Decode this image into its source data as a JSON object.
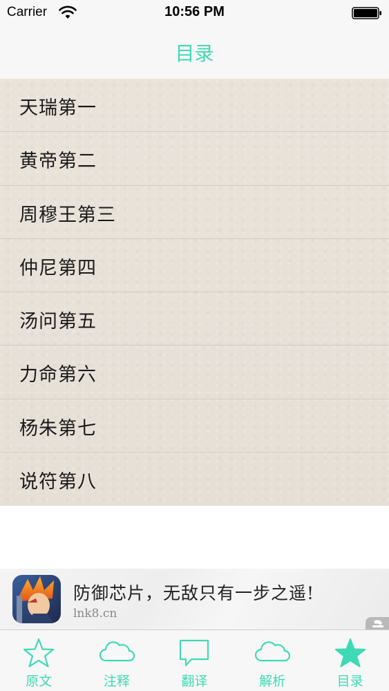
{
  "status_bar": {
    "carrier": "Carrier",
    "time": "10:56 PM",
    "wifi_icon": "wifi-icon",
    "battery_icon": "battery-icon"
  },
  "nav": {
    "title": "目录"
  },
  "toc": {
    "items": [
      {
        "label": "天瑞第一"
      },
      {
        "label": "黄帝第二"
      },
      {
        "label": "周穆王第三"
      },
      {
        "label": "仲尼第四"
      },
      {
        "label": "汤问第五"
      },
      {
        "label": "力命第六"
      },
      {
        "label": "杨朱第七"
      },
      {
        "label": "说符第八"
      }
    ]
  },
  "ad": {
    "title": "防御芯片，无敌只有一步之遥!",
    "url": "lnk8.cn"
  },
  "tabs": [
    {
      "label": "原文",
      "icon": "star-outline-icon"
    },
    {
      "label": "注释",
      "icon": "cloud-icon"
    },
    {
      "label": "翻译",
      "icon": "speech-bubble-icon"
    },
    {
      "label": "解析",
      "icon": "cloud-icon"
    },
    {
      "label": "目录",
      "icon": "star-filled-icon"
    }
  ],
  "colors": {
    "accent": "#3fd9b6",
    "list_background": "#e8e1d8",
    "bar_background": "#f7f7f7"
  }
}
